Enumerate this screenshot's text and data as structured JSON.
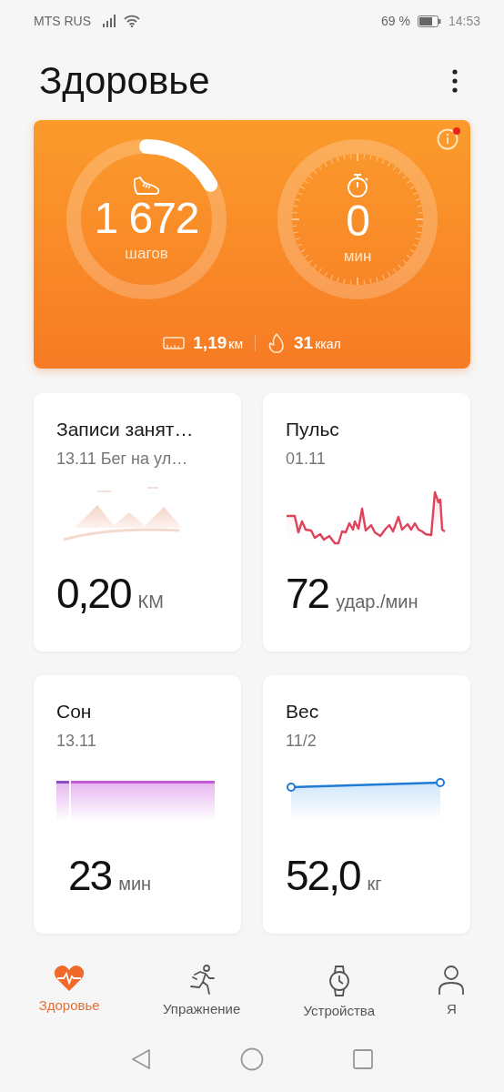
{
  "status_bar": {
    "carrier": "MTS RUS",
    "battery": "69 %",
    "time": "14:53"
  },
  "header": {
    "title": "Здоровье"
  },
  "summary": {
    "rings": [
      {
        "kind": "steps",
        "value": "1 672",
        "unit": "шагов"
      },
      {
        "kind": "timer",
        "value": "0",
        "unit": "мин"
      }
    ],
    "info_alert": true,
    "distance": {
      "value": "1,19",
      "unit": "км"
    },
    "calories": {
      "value": "31",
      "unit": "ккал"
    }
  },
  "cards": [
    {
      "kind": "activity",
      "title": "Записи занят…",
      "subtitle": "13.11 Бег на ул…",
      "value": "0,20",
      "unit": "КМ"
    },
    {
      "kind": "heart",
      "title": "Пульс",
      "subtitle": "01.11",
      "value": "72",
      "unit": "удар./мин"
    },
    {
      "kind": "sleep",
      "title": "Сон",
      "subtitle": "13.11",
      "value": "23",
      "unit": "мин"
    },
    {
      "kind": "weight",
      "title": "Вес",
      "subtitle": "11/2",
      "value": "52,0",
      "unit": "кг"
    }
  ],
  "tabs": [
    {
      "kind": "health",
      "label": "Здоровье",
      "selected": true
    },
    {
      "kind": "exercise",
      "label": "Упражнение",
      "selected": false
    },
    {
      "kind": "devices",
      "label": "Устройства",
      "selected": false
    },
    {
      "kind": "me",
      "label": "Я",
      "selected": false
    }
  ]
}
